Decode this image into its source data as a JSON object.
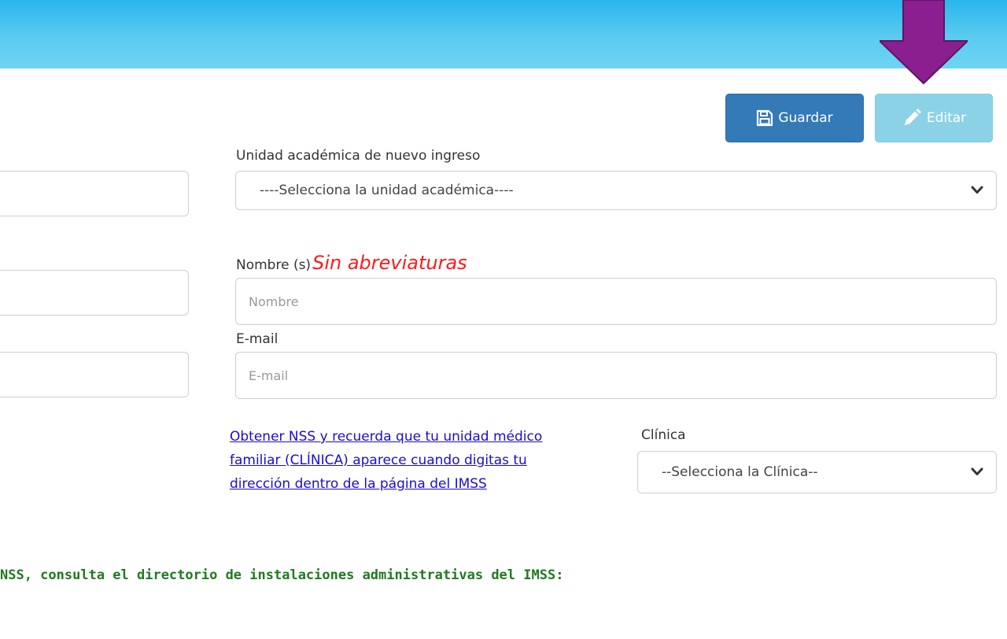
{
  "toolbar": {
    "save_label": "Guardar",
    "edit_label": "Editar"
  },
  "form": {
    "unidad_label": "Unidad académica de nuevo ingreso",
    "unidad_selected": "----Selecciona la unidad académica----",
    "nombre_label": "Nombre (s)",
    "nombre_hint": "Sin abreviaturas",
    "nombre_placeholder": "Nombre",
    "email_label": "E-mail",
    "email_placeholder": "E-mail",
    "nss_link": "Obtener NSS y recuerda que tu unidad médico familiar (CLÍNICA) aparece cuando digitas tu dirección dentro de la página del IMSS",
    "clinica_label": "Clínica",
    "clinica_selected": "--Selecciona la Clínica--"
  },
  "note": {
    "text": "NSS, consulta el directorio de instalaciones administrativas del IMSS:"
  },
  "colors": {
    "header": "#5ccbf1",
    "save_button": "#337ab7",
    "edit_button": "#5bc0de",
    "arrow": "#8b1f8f",
    "hint": "#ff1a1a",
    "link": "#1a0dcc",
    "note": "#1f7a1f"
  }
}
